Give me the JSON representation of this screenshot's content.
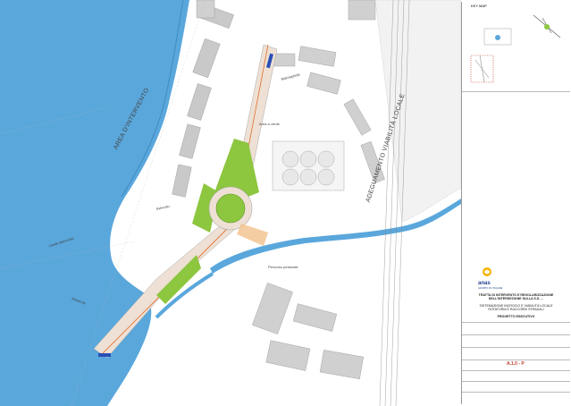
{
  "map": {
    "area_label": "AREA D'INTERVENTO",
    "wall_label": "ADEGUAMENTO VIABILITÀ LOCALE",
    "callouts": [
      "Limite intervento",
      "Svincolo",
      "Area a verde",
      "Percorso pedonale",
      "Marciapiede",
      "Rotatoria"
    ]
  },
  "title_block": {
    "keymap_label": "KEY MAP",
    "company": "anas",
    "company_sub": "GRUPPO FS ITALIANE",
    "project_title": "TRATTA DI INTERVENTO E REGOLARIZZAZIONE DELL'INTERSEZIONE SULLA S.S. ...",
    "project_lines": [
      "SISTEMAZIONE INCROCIO E VIABILITÀ LOCALE",
      "ROTATORIA E RACCORDI STRADALI"
    ],
    "phase_label": "PROGETTO ESECUTIVO",
    "doc_code": "A.1.0 - P",
    "colors": {
      "accent": "#c0392b",
      "water": "#5aa7dc",
      "green": "#8dc63f",
      "road": "#e9e3dc"
    }
  }
}
